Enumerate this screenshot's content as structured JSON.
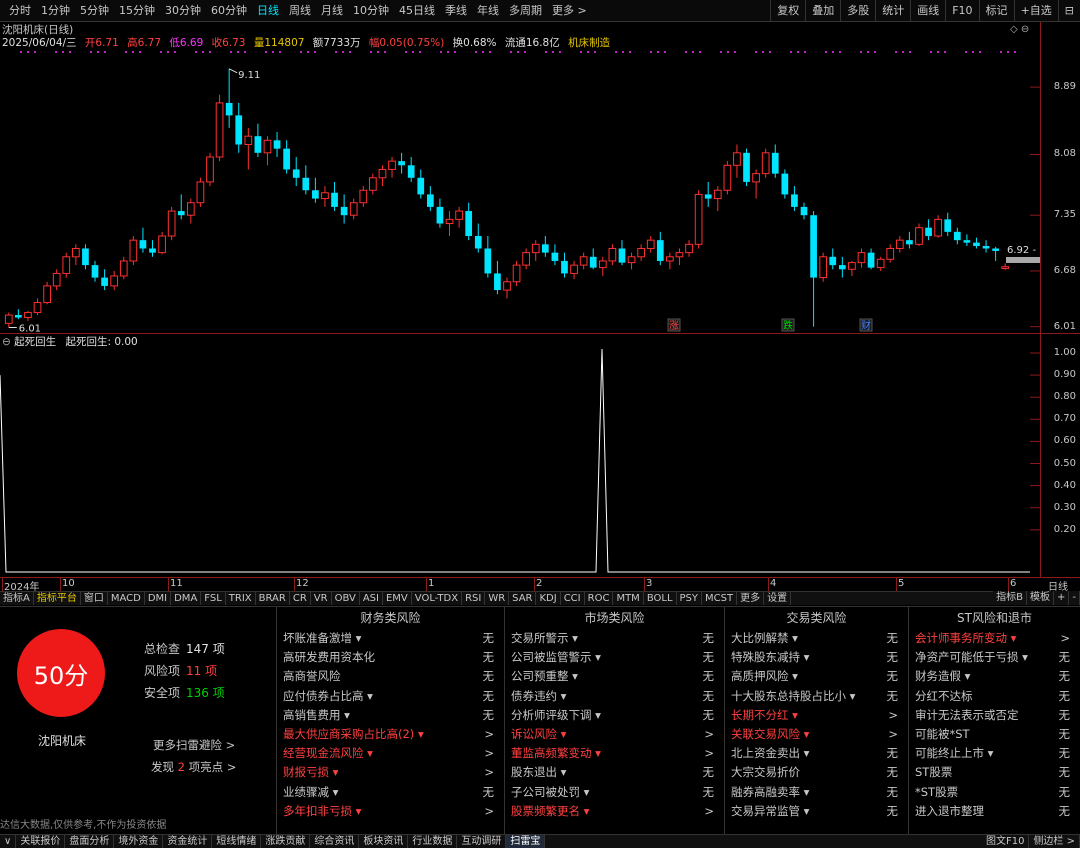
{
  "toolbar": {
    "periods": [
      "分时",
      "1分钟",
      "5分钟",
      "15分钟",
      "30分钟",
      "60分钟",
      "日线",
      "周线",
      "月线",
      "10分钟",
      "45日线",
      "季线",
      "年线",
      "多周期",
      "更多 >"
    ],
    "active_period": "日线",
    "tools": [
      "复权",
      "叠加",
      "多股",
      "统计",
      "画线",
      "F10",
      "标记",
      "+自选",
      "⊟"
    ]
  },
  "chart": {
    "title": "沈阳机床(日线)",
    "info": {
      "date": "2025/06/04/三",
      "open": "开6.71",
      "high": "高6.77",
      "low": "低6.69",
      "close": "收6.73",
      "volume": "量114807",
      "amount": "额7733万",
      "change": "幅0.05(0.75%)",
      "turnover": "换0.68%",
      "float": "流通16.8亿",
      "sector": "机床制造"
    },
    "y_labels": [
      "8.89",
      "8.08",
      "7.35",
      "6.68",
      "6.01"
    ],
    "max_label": "9.11",
    "min_label": "6.01",
    "last_label": "6.92 -",
    "events": [
      "涨",
      "跌",
      "财"
    ],
    "candles": [
      [
        6.05,
        6.18,
        6.0,
        6.15
      ],
      [
        6.15,
        6.22,
        6.1,
        6.12
      ],
      [
        6.12,
        6.2,
        6.08,
        6.18
      ],
      [
        6.18,
        6.35,
        6.15,
        6.3
      ],
      [
        6.3,
        6.55,
        6.28,
        6.5
      ],
      [
        6.5,
        6.7,
        6.45,
        6.65
      ],
      [
        6.65,
        6.9,
        6.6,
        6.85
      ],
      [
        6.85,
        7.0,
        6.75,
        6.95
      ],
      [
        6.95,
        7.0,
        6.7,
        6.75
      ],
      [
        6.75,
        6.8,
        6.55,
        6.6
      ],
      [
        6.6,
        6.7,
        6.45,
        6.5
      ],
      [
        6.5,
        6.68,
        6.45,
        6.62
      ],
      [
        6.62,
        6.85,
        6.58,
        6.8
      ],
      [
        6.8,
        7.1,
        6.75,
        7.05
      ],
      [
        7.05,
        7.2,
        6.9,
        6.95
      ],
      [
        6.95,
        7.05,
        6.85,
        6.9
      ],
      [
        6.9,
        7.15,
        6.88,
        7.1
      ],
      [
        7.1,
        7.45,
        7.05,
        7.4
      ],
      [
        7.4,
        7.6,
        7.3,
        7.35
      ],
      [
        7.35,
        7.55,
        7.25,
        7.5
      ],
      [
        7.5,
        7.8,
        7.45,
        7.75
      ],
      [
        7.75,
        8.1,
        7.7,
        8.05
      ],
      [
        8.05,
        8.8,
        8.0,
        8.7
      ],
      [
        8.7,
        9.11,
        8.4,
        8.55
      ],
      [
        8.55,
        8.7,
        8.1,
        8.2
      ],
      [
        8.2,
        8.4,
        7.9,
        8.3
      ],
      [
        8.3,
        8.45,
        8.05,
        8.1
      ],
      [
        8.1,
        8.3,
        7.95,
        8.25
      ],
      [
        8.25,
        8.35,
        8.05,
        8.15
      ],
      [
        8.15,
        8.25,
        7.85,
        7.9
      ],
      [
        7.9,
        8.05,
        7.7,
        7.8
      ],
      [
        7.8,
        7.95,
        7.6,
        7.65
      ],
      [
        7.65,
        7.8,
        7.5,
        7.55
      ],
      [
        7.55,
        7.7,
        7.45,
        7.62
      ],
      [
        7.62,
        7.75,
        7.4,
        7.45
      ],
      [
        7.45,
        7.6,
        7.25,
        7.35
      ],
      [
        7.35,
        7.55,
        7.3,
        7.5
      ],
      [
        7.5,
        7.7,
        7.45,
        7.65
      ],
      [
        7.65,
        7.85,
        7.6,
        7.8
      ],
      [
        7.8,
        7.95,
        7.7,
        7.9
      ],
      [
        7.9,
        8.05,
        7.8,
        8.0
      ],
      [
        8.0,
        8.1,
        7.85,
        7.95
      ],
      [
        7.95,
        8.05,
        7.75,
        7.8
      ],
      [
        7.8,
        7.9,
        7.55,
        7.6
      ],
      [
        7.6,
        7.7,
        7.4,
        7.45
      ],
      [
        7.45,
        7.55,
        7.2,
        7.25
      ],
      [
        7.25,
        7.4,
        7.1,
        7.3
      ],
      [
        7.3,
        7.45,
        7.2,
        7.4
      ],
      [
        7.4,
        7.5,
        7.05,
        7.1
      ],
      [
        7.1,
        7.25,
        6.9,
        6.95
      ],
      [
        6.95,
        7.1,
        6.6,
        6.65
      ],
      [
        6.65,
        6.8,
        6.4,
        6.45
      ],
      [
        6.45,
        6.6,
        6.35,
        6.55
      ],
      [
        6.55,
        6.8,
        6.5,
        6.75
      ],
      [
        6.75,
        6.95,
        6.7,
        6.9
      ],
      [
        6.9,
        7.05,
        6.8,
        7.0
      ],
      [
        7.0,
        7.1,
        6.85,
        6.9
      ],
      [
        6.9,
        7.0,
        6.75,
        6.8
      ],
      [
        6.8,
        6.9,
        6.6,
        6.65
      ],
      [
        6.65,
        6.8,
        6.58,
        6.75
      ],
      [
        6.75,
        6.9,
        6.7,
        6.85
      ],
      [
        6.85,
        6.95,
        6.7,
        6.72
      ],
      [
        6.72,
        6.85,
        6.62,
        6.8
      ],
      [
        6.8,
        7.0,
        6.75,
        6.95
      ],
      [
        6.95,
        7.05,
        6.75,
        6.78
      ],
      [
        6.78,
        6.9,
        6.7,
        6.85
      ],
      [
        6.85,
        7.0,
        6.8,
        6.95
      ],
      [
        6.95,
        7.1,
        6.9,
        7.05
      ],
      [
        7.05,
        7.15,
        6.75,
        6.8
      ],
      [
        6.8,
        6.9,
        6.7,
        6.85
      ],
      [
        6.85,
        6.95,
        6.75,
        6.9
      ],
      [
        6.9,
        7.05,
        6.85,
        7.0
      ],
      [
        7.0,
        7.65,
        6.95,
        7.6
      ],
      [
        7.6,
        7.75,
        7.45,
        7.55
      ],
      [
        7.55,
        7.7,
        7.4,
        7.65
      ],
      [
        7.65,
        8.0,
        7.6,
        7.95
      ],
      [
        7.95,
        8.2,
        7.8,
        8.1
      ],
      [
        8.1,
        8.15,
        7.7,
        7.75
      ],
      [
        7.75,
        7.9,
        7.55,
        7.85
      ],
      [
        7.85,
        8.15,
        7.8,
        8.1
      ],
      [
        8.1,
        8.2,
        7.8,
        7.85
      ],
      [
        7.85,
        7.9,
        7.55,
        7.6
      ],
      [
        7.6,
        7.7,
        7.4,
        7.45
      ],
      [
        7.45,
        7.5,
        7.3,
        7.35
      ],
      [
        7.35,
        7.4,
        6.01,
        6.6
      ],
      [
        6.6,
        6.9,
        6.55,
        6.85
      ],
      [
        6.85,
        6.95,
        6.7,
        6.75
      ],
      [
        6.75,
        6.85,
        6.6,
        6.7
      ],
      [
        6.7,
        6.8,
        6.62,
        6.78
      ],
      [
        6.78,
        6.95,
        6.72,
        6.9
      ],
      [
        6.9,
        6.95,
        6.7,
        6.72
      ],
      [
        6.72,
        6.85,
        6.68,
        6.82
      ],
      [
        6.82,
        7.0,
        6.78,
        6.95
      ],
      [
        6.95,
        7.1,
        6.9,
        7.05
      ],
      [
        7.05,
        7.15,
        6.95,
        7.0
      ],
      [
        7.0,
        7.25,
        6.98,
        7.2
      ],
      [
        7.2,
        7.3,
        7.05,
        7.1
      ],
      [
        7.1,
        7.35,
        7.08,
        7.3
      ],
      [
        7.3,
        7.38,
        7.1,
        7.15
      ],
      [
        7.15,
        7.2,
        7.0,
        7.05
      ],
      [
        7.05,
        7.12,
        6.98,
        7.02
      ],
      [
        7.02,
        7.08,
        6.95,
        6.98
      ],
      [
        6.98,
        7.05,
        6.9,
        6.95
      ],
      [
        6.95,
        6.97,
        6.8,
        6.92
      ],
      [
        6.71,
        6.77,
        6.69,
        6.73
      ]
    ],
    "indicator_name": "起死回生",
    "indicator_label": "起死回生: 0.00",
    "indicator_y_labels": [
      "1.00",
      "0.90",
      "0.80",
      "0.70",
      "0.60",
      "0.50",
      "0.40",
      "0.30",
      "0.20"
    ],
    "dates": [
      "2024年",
      "10",
      "11",
      "12",
      "1",
      "2",
      "3",
      "4",
      "5",
      "6"
    ],
    "period_label": "日线"
  },
  "indicator_tabs": [
    "指标A",
    "指标平台",
    "窗口",
    "MACD",
    "DMI",
    "DMA",
    "FSL",
    "TRIX",
    "BRAR",
    "CR",
    "VR",
    "OBV",
    "ASI",
    "EMV",
    "VOL-TDX",
    "RSI",
    "WR",
    "SAR",
    "KDJ",
    "CCI",
    "ROC",
    "MTM",
    "BOLL",
    "PSY",
    "MCST",
    "更多",
    "设置"
  ],
  "indicator_tabs_active": "指标平台",
  "right_tabs": [
    "指标B",
    "模板",
    "+",
    "-"
  ],
  "scan": {
    "score": "50分",
    "stock_name": "沈阳机床",
    "total_label": "总检查",
    "total_value": "147 项",
    "risk_label": "风险项",
    "risk_value": "11 项",
    "safe_label": "安全项",
    "safe_value": "136 项",
    "more_link": "更多扫雷避险 >",
    "found_prefix": "发现",
    "found_count": "2",
    "found_suffix": "项亮点 >",
    "disclaimer": "达信大数据,仅供参考,不作为投资依据",
    "columns": [
      {
        "title": "财务类风险",
        "items": [
          {
            "label": "坏账准备激增 ▾",
            "status": "无",
            "hl": false
          },
          {
            "label": "高研发费用资本化",
            "status": "无",
            "hl": false
          },
          {
            "label": "高商誉风险",
            "status": "无",
            "hl": false
          },
          {
            "label": "应付债券占比高 ▾",
            "status": "无",
            "hl": false
          },
          {
            "label": "高销售费用 ▾",
            "status": "无",
            "hl": false
          },
          {
            "label": "最大供应商采购占比高(2) ▾",
            "status": ">",
            "hl": true
          },
          {
            "label": "经营现金流风险 ▾",
            "status": ">",
            "hl": true
          },
          {
            "label": "财报亏损 ▾",
            "status": ">",
            "hl": true
          },
          {
            "label": "业绩骤减 ▾",
            "status": "无",
            "hl": false
          },
          {
            "label": "多年扣非亏损 ▾",
            "status": ">",
            "hl": true
          }
        ]
      },
      {
        "title": "市场类风险",
        "items": [
          {
            "label": "交易所警示 ▾",
            "status": "无",
            "hl": false
          },
          {
            "label": "公司被监管警示 ▾",
            "status": "无",
            "hl": false
          },
          {
            "label": "公司预重整 ▾",
            "status": "无",
            "hl": false
          },
          {
            "label": "债券违约 ▾",
            "status": "无",
            "hl": false
          },
          {
            "label": "分析师评级下调 ▾",
            "status": "无",
            "hl": false
          },
          {
            "label": "诉讼风险 ▾",
            "status": ">",
            "hl": true
          },
          {
            "label": "董监高频繁变动 ▾",
            "status": ">",
            "hl": true
          },
          {
            "label": "股东退出 ▾",
            "status": "无",
            "hl": false
          },
          {
            "label": "子公司被处罚 ▾",
            "status": "无",
            "hl": false
          },
          {
            "label": "股票频繁更名 ▾",
            "status": ">",
            "hl": true
          }
        ]
      },
      {
        "title": "交易类风险",
        "items": [
          {
            "label": "大比例解禁 ▾",
            "status": "无",
            "hl": false
          },
          {
            "label": "特殊股东减持 ▾",
            "status": "无",
            "hl": false
          },
          {
            "label": "高质押风险 ▾",
            "status": "无",
            "hl": false
          },
          {
            "label": "十大股东总持股占比小 ▾",
            "status": "无",
            "hl": false
          },
          {
            "label": "长期不分红 ▾",
            "status": ">",
            "hl": true
          },
          {
            "label": "关联交易风险 ▾",
            "status": ">",
            "hl": true
          },
          {
            "label": "北上资金卖出 ▾",
            "status": "无",
            "hl": false
          },
          {
            "label": "大宗交易折价",
            "status": "无",
            "hl": false
          },
          {
            "label": "融券高融卖率 ▾",
            "status": "无",
            "hl": false
          },
          {
            "label": "交易异常监管 ▾",
            "status": "无",
            "hl": false
          }
        ]
      },
      {
        "title": "ST风险和退市",
        "items": [
          {
            "label": "会计师事务所变动 ▾",
            "status": ">",
            "hl": true
          },
          {
            "label": "净资产可能低于亏损 ▾",
            "status": "无",
            "hl": false
          },
          {
            "label": "财务造假 ▾",
            "status": "无",
            "hl": false
          },
          {
            "label": "分红不达标",
            "status": "无",
            "hl": false
          },
          {
            "label": "审计无法表示或否定",
            "status": "无",
            "hl": false
          },
          {
            "label": "可能被*ST",
            "status": "无",
            "hl": false
          },
          {
            "label": "可能终止上市 ▾",
            "status": "无",
            "hl": false
          },
          {
            "label": "ST股票",
            "status": "无",
            "hl": false
          },
          {
            "label": "*ST股票",
            "status": "无",
            "hl": false
          },
          {
            "label": "进入退市整理",
            "status": "无",
            "hl": false
          }
        ]
      }
    ]
  },
  "bottom_tabs": [
    "关联报价",
    "盘面分析",
    "境外资金",
    "资金统计",
    "短线情绪",
    "涨跌贡献",
    "综合资讯",
    "板块资讯",
    "行业数据",
    "互动调研",
    "扫雷宝"
  ],
  "bottom_tabs_active": "扫雷宝",
  "bottom_left": "∨",
  "bottom_right": [
    "图文F10",
    "侧边栏 >"
  ]
}
